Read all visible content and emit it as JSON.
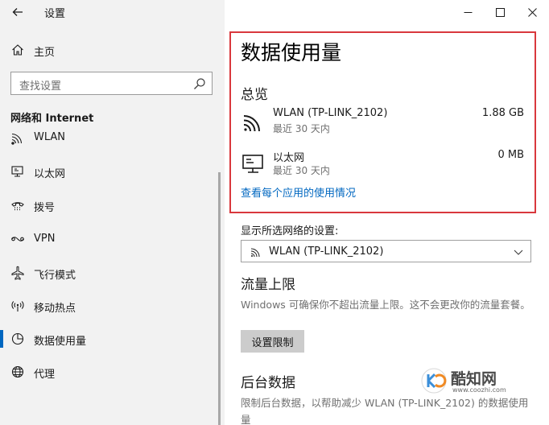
{
  "window": {
    "app_title": "设置",
    "controls": [
      "minimize-icon",
      "maximize-icon",
      "close-icon"
    ]
  },
  "sidebar": {
    "home_label": "主页",
    "search_placeholder": "查找设置",
    "section_header": "网络和 Internet",
    "items": [
      {
        "label": "WLAN",
        "icon": "wifi-icon",
        "selected": false
      },
      {
        "label": "以太网",
        "icon": "ethernet-icon",
        "selected": false
      },
      {
        "label": "拨号",
        "icon": "dialup-icon",
        "selected": false
      },
      {
        "label": "VPN",
        "icon": "vpn-icon",
        "selected": false
      },
      {
        "label": "飞行模式",
        "icon": "airplane-icon",
        "selected": false
      },
      {
        "label": "移动热点",
        "icon": "hotspot-icon",
        "selected": false
      },
      {
        "label": "数据使用量",
        "icon": "data-usage-icon",
        "selected": true
      },
      {
        "label": "代理",
        "icon": "globe-icon",
        "selected": false
      }
    ]
  },
  "main": {
    "page_title": "数据使用量",
    "overview_heading": "总览",
    "networks": [
      {
        "name": "WLAN (TP-LINK_2102)",
        "period": "最近 30 天内",
        "amount": "1.88 GB",
        "icon": "wifi-icon"
      },
      {
        "name": "以太网",
        "period": "最近 30 天内",
        "amount": "0 MB",
        "icon": "ethernet-icon"
      }
    ],
    "per_app_link": "查看每个应用的使用情况",
    "network_select_label": "显示所选网络的设置:",
    "network_select_value": "WLAN (TP-LINK_2102)",
    "limit_heading": "流量上限",
    "limit_desc": "Windows 可确保你不超出流量上限。这不会更改你的流量套餐。",
    "set_limit_button": "设置限制",
    "background_heading": "后台数据",
    "background_desc": "限制后台数据，以帮助减少 WLAN (TP-LINK_2102) 的数据使用量"
  },
  "watermark": {
    "text": "酷知网",
    "url": "www.coozhi.com"
  },
  "colors": {
    "accent": "#0067c0",
    "highlight_border": "#d9383d",
    "sidebar_bg": "#f2f2f2",
    "button_bg": "#cccccc"
  }
}
